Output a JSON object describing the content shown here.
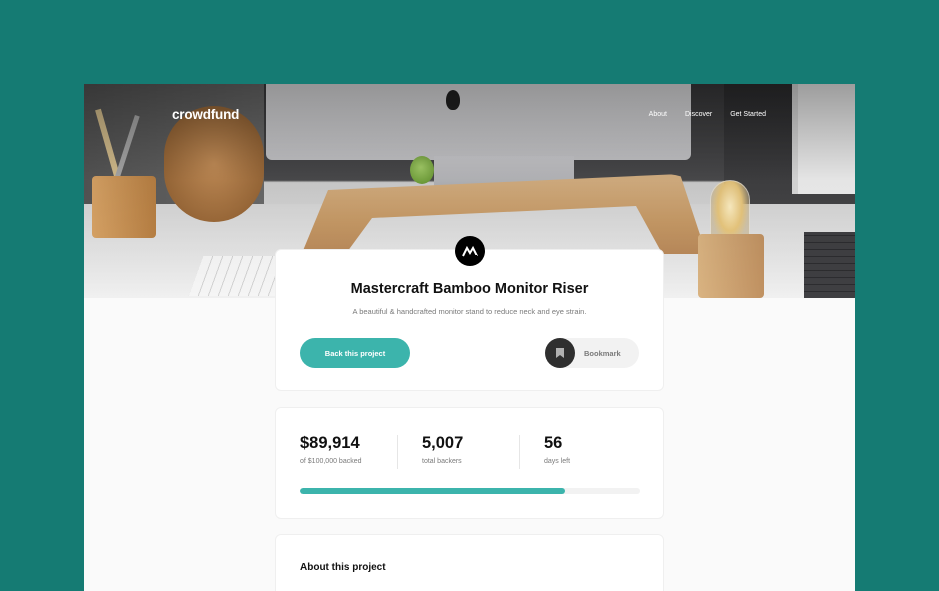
{
  "nav": {
    "logo": "crowdfund",
    "links": [
      "About",
      "Discover",
      "Get Started"
    ]
  },
  "project": {
    "title": "Mastercraft Bamboo Monitor Riser",
    "description": "A beautiful & handcrafted monitor stand to reduce neck and eye strain.",
    "back_label": "Back this project",
    "bookmark_label": "Bookmark"
  },
  "stats": {
    "backed_amount": "$89,914",
    "backed_label": "of $100,000 backed",
    "backers": "5,007",
    "backers_label": "total backers",
    "days": "56",
    "days_label": "days left",
    "progress_fraction": 0.78
  },
  "about": {
    "title": "About this project"
  },
  "colors": {
    "background": "#157B73",
    "accent": "#3CB4AC",
    "dark": "#2F2F2F"
  },
  "icons": {
    "brand": "mastercraft-logo-icon",
    "bookmark": "bookmark-icon"
  }
}
